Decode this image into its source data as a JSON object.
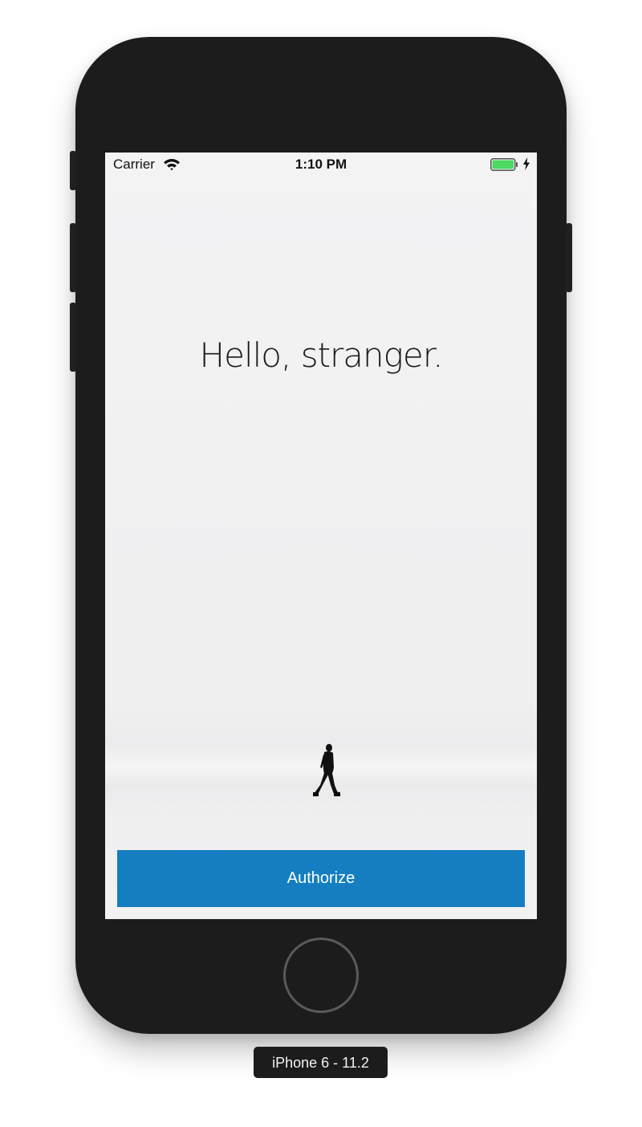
{
  "status_bar": {
    "carrier": "Carrier",
    "time": "1:10 PM",
    "wifi_icon": "wifi-icon",
    "battery_icon": "battery-icon",
    "charging_icon": "charging-bolt-icon",
    "battery_level": 1.0,
    "battery_color": "#4cd964"
  },
  "main": {
    "headline": "Hello, stranger.",
    "authorize_label": "Authorize",
    "accent_color": "#157ec0"
  },
  "device": {
    "label": "iPhone 6 - 11.2",
    "frame_color": "#1c1c1c"
  }
}
